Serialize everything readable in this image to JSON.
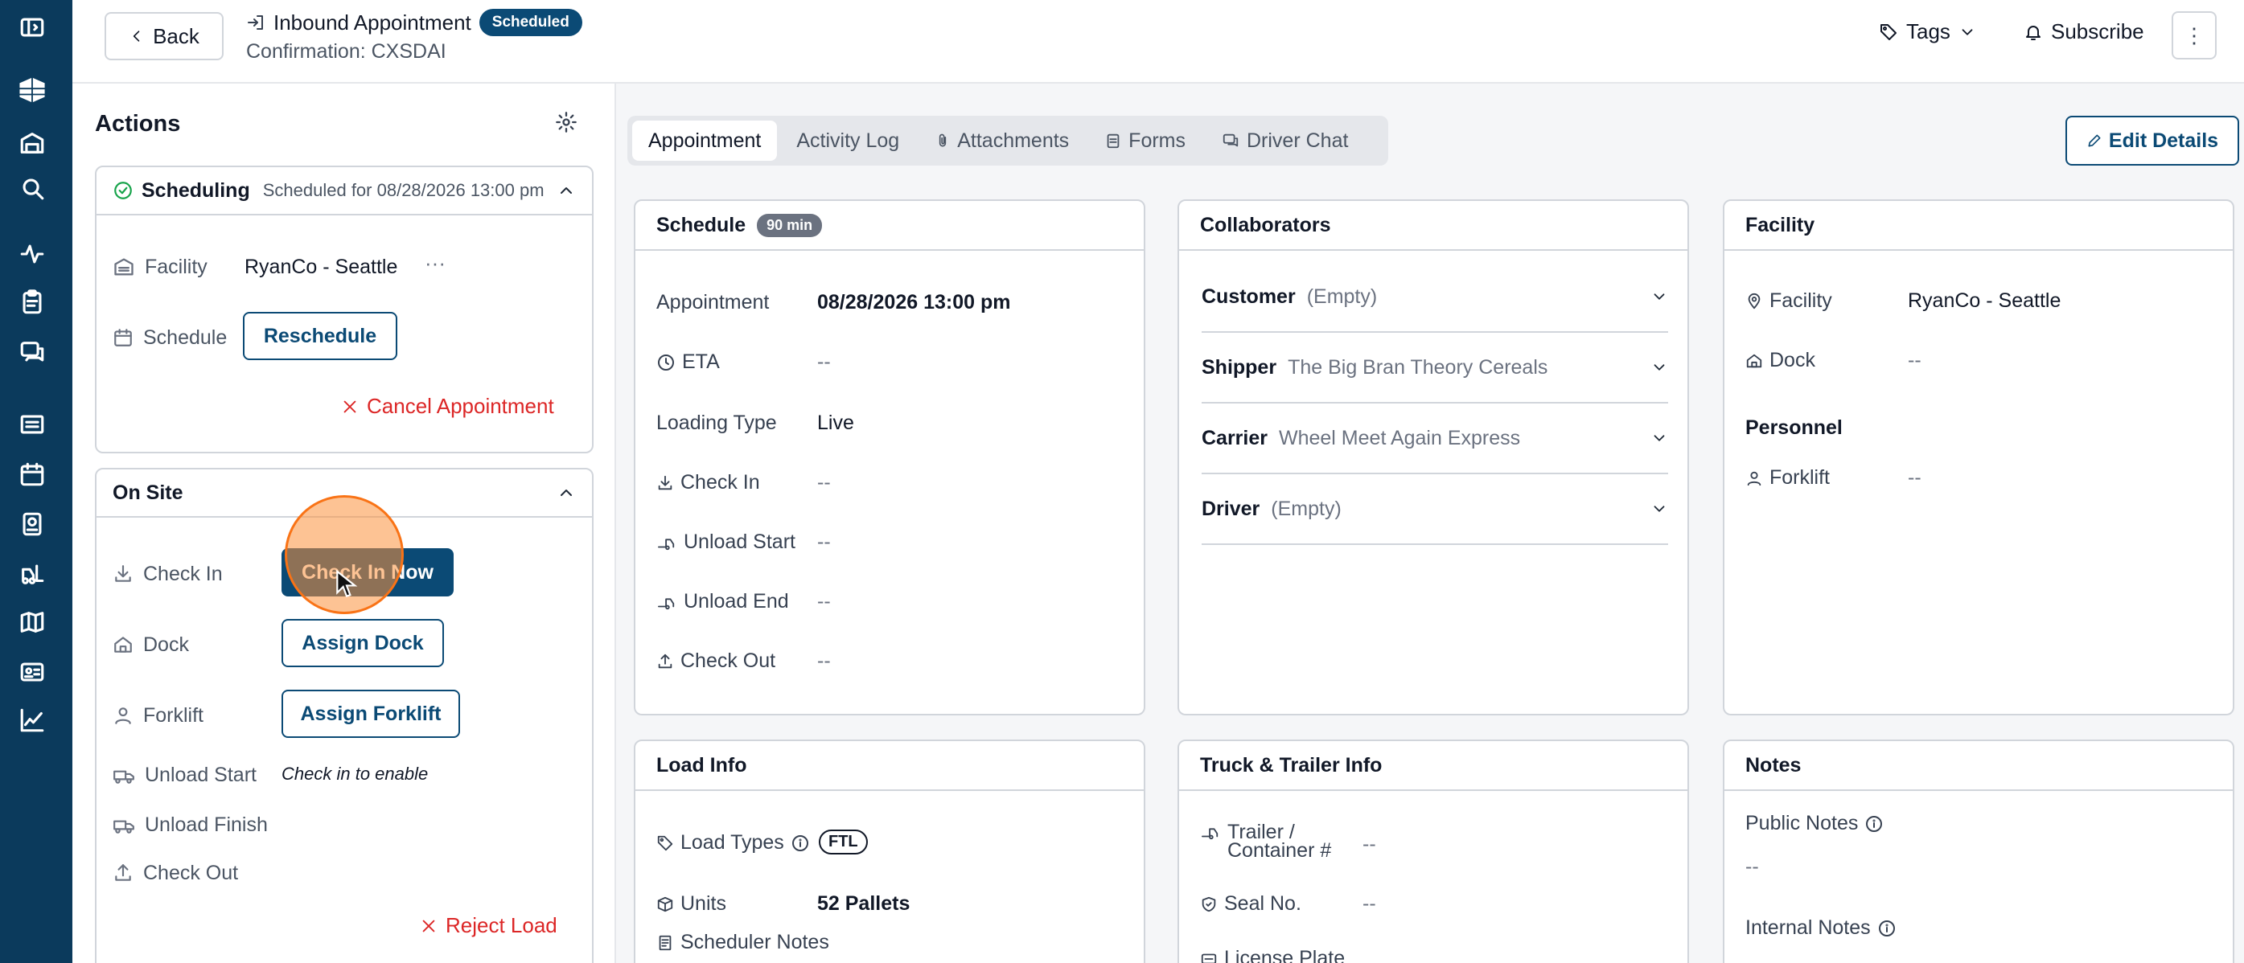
{
  "header": {
    "back_label": "Back",
    "title": "Inbound Appointment",
    "status_badge": "Scheduled",
    "confirmation": "Confirmation: CXSDAI",
    "tags_label": "Tags",
    "subscribe_label": "Subscribe"
  },
  "sidebar": {
    "icons": [
      "sidebar-toggle-icon",
      "logo-icon",
      "warehouse-icon",
      "search-icon",
      "activity-icon",
      "clipboard-icon",
      "chat-icon",
      "list-icon",
      "calendar-icon",
      "dock-icon",
      "forklift-icon",
      "map-icon",
      "id-card-icon",
      "analytics-icon"
    ]
  },
  "actions": {
    "title": "Actions",
    "scheduling": {
      "title": "Scheduling",
      "subtitle": "Scheduled for 08/28/2026 13:00 pm",
      "facility_label": "Facility",
      "facility_value": "RyanCo - Seattle",
      "schedule_label": "Schedule",
      "reschedule_label": "Reschedule",
      "cancel_label": "Cancel Appointment"
    },
    "onsite": {
      "title": "On Site",
      "checkin_label": "Check In",
      "checkin_button": "Check In Now",
      "dock_label": "Dock",
      "dock_button": "Assign Dock",
      "forklift_label": "Forklift",
      "forklift_button": "Assign Forklift",
      "unload_start_label": "Unload Start",
      "unload_hint": "Check in to enable",
      "unload_finish_label": "Unload Finish",
      "checkout_label": "Check Out",
      "reject_label": "Reject Load"
    }
  },
  "tabs": [
    "Appointment",
    "Activity Log",
    "Attachments",
    "Forms",
    "Driver Chat"
  ],
  "edit_details_label": "Edit Details",
  "schedule": {
    "title": "Schedule",
    "duration": "90 min",
    "rows": [
      {
        "label": "Appointment",
        "value": "08/28/2026 13:00 pm"
      },
      {
        "label": "ETA",
        "value": "--"
      },
      {
        "label": "Loading Type",
        "value": "Live"
      },
      {
        "label": "Check In",
        "value": "--"
      },
      {
        "label": "Unload Start",
        "value": "--"
      },
      {
        "label": "Unload End",
        "value": "--"
      },
      {
        "label": "Check Out",
        "value": "--"
      }
    ]
  },
  "collaborators": {
    "title": "Collaborators",
    "rows": [
      {
        "label": "Customer",
        "value": "(Empty)"
      },
      {
        "label": "Shipper",
        "value": "The Big Bran Theory Cereals"
      },
      {
        "label": "Carrier",
        "value": "Wheel Meet Again Express"
      },
      {
        "label": "Driver",
        "value": "(Empty)"
      }
    ]
  },
  "facility": {
    "title": "Facility",
    "facility_label": "Facility",
    "facility_value": "RyanCo - Seattle",
    "dock_label": "Dock",
    "dock_value": "--",
    "personnel_label": "Personnel",
    "forklift_label": "Forklift",
    "forklift_value": "--"
  },
  "load_info": {
    "title": "Load Info",
    "load_types_label": "Load Types",
    "load_types_value": "FTL",
    "units_label": "Units",
    "units_value": "52 Pallets",
    "scheduler_notes_label": "Scheduler Notes"
  },
  "truck_info": {
    "title": "Truck & Trailer Info",
    "trailer_label_1": "Trailer /",
    "trailer_label_2": "Container #",
    "trailer_value": "--",
    "seal_label": "Seal No.",
    "seal_value": "--",
    "plate_label": "License Plate"
  },
  "notes": {
    "title": "Notes",
    "public_label": "Public Notes",
    "public_value": "--",
    "internal_label": "Internal Notes"
  }
}
